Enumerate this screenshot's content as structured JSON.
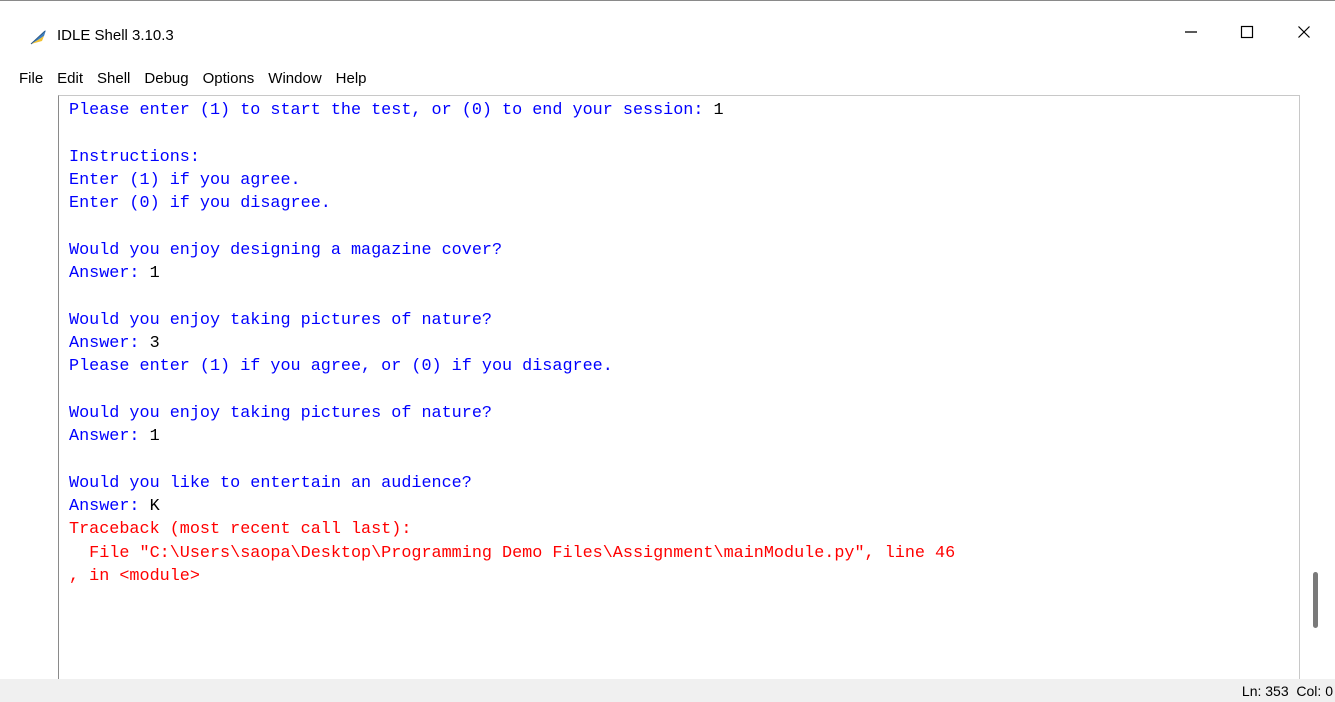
{
  "window": {
    "title": "IDLE Shell 3.10.3",
    "icon": "python-feather-icon"
  },
  "controls": {
    "minimize_icon": "minimize-icon",
    "maximize_icon": "maximize-icon",
    "close_icon": "close-icon"
  },
  "menu": {
    "items": [
      "File",
      "Edit",
      "Shell",
      "Debug",
      "Options",
      "Window",
      "Help"
    ]
  },
  "shell": {
    "lines": [
      {
        "text": "Please enter (1) to start the test, or (0) to end your session: ",
        "input": "1",
        "kind": "stdout"
      },
      {
        "text": "",
        "kind": "stdout"
      },
      {
        "text": "Instructions:",
        "kind": "stdout"
      },
      {
        "text": "Enter (1) if you agree.",
        "kind": "stdout"
      },
      {
        "text": "Enter (0) if you disagree.",
        "kind": "stdout"
      },
      {
        "text": "",
        "kind": "stdout"
      },
      {
        "text": "Would you enjoy designing a magazine cover?",
        "kind": "stdout"
      },
      {
        "text": "Answer: ",
        "input": "1",
        "kind": "stdout"
      },
      {
        "text": "",
        "kind": "stdout"
      },
      {
        "text": "Would you enjoy taking pictures of nature?",
        "kind": "stdout"
      },
      {
        "text": "Answer: ",
        "input": "3",
        "kind": "stdout"
      },
      {
        "text": "Please enter (1) if you agree, or (0) if you disagree.",
        "kind": "stdout"
      },
      {
        "text": "",
        "kind": "stdout"
      },
      {
        "text": "Would you enjoy taking pictures of nature?",
        "kind": "stdout"
      },
      {
        "text": "Answer: ",
        "input": "1",
        "kind": "stdout"
      },
      {
        "text": "",
        "kind": "stdout"
      },
      {
        "text": "Would you like to entertain an audience?",
        "kind": "stdout"
      },
      {
        "text": "Answer: ",
        "input": "K",
        "kind": "stdout"
      },
      {
        "text": "Traceback (most recent call last):",
        "kind": "stderr"
      },
      {
        "text": "  File \"C:\\Users\\saopa\\Desktop\\Programming Demo Files\\Assignment\\mainModule.py\", line 46",
        "kind": "stderr"
      },
      {
        "text": ", in <module>",
        "kind": "stderr"
      }
    ]
  },
  "colors": {
    "stdout": "#0000ff",
    "stdin": "#000000",
    "stderr": "#ff0000"
  },
  "status": {
    "ln_label": "Ln: ",
    "ln": "353",
    "col_label": "Col: ",
    "col": "0"
  }
}
